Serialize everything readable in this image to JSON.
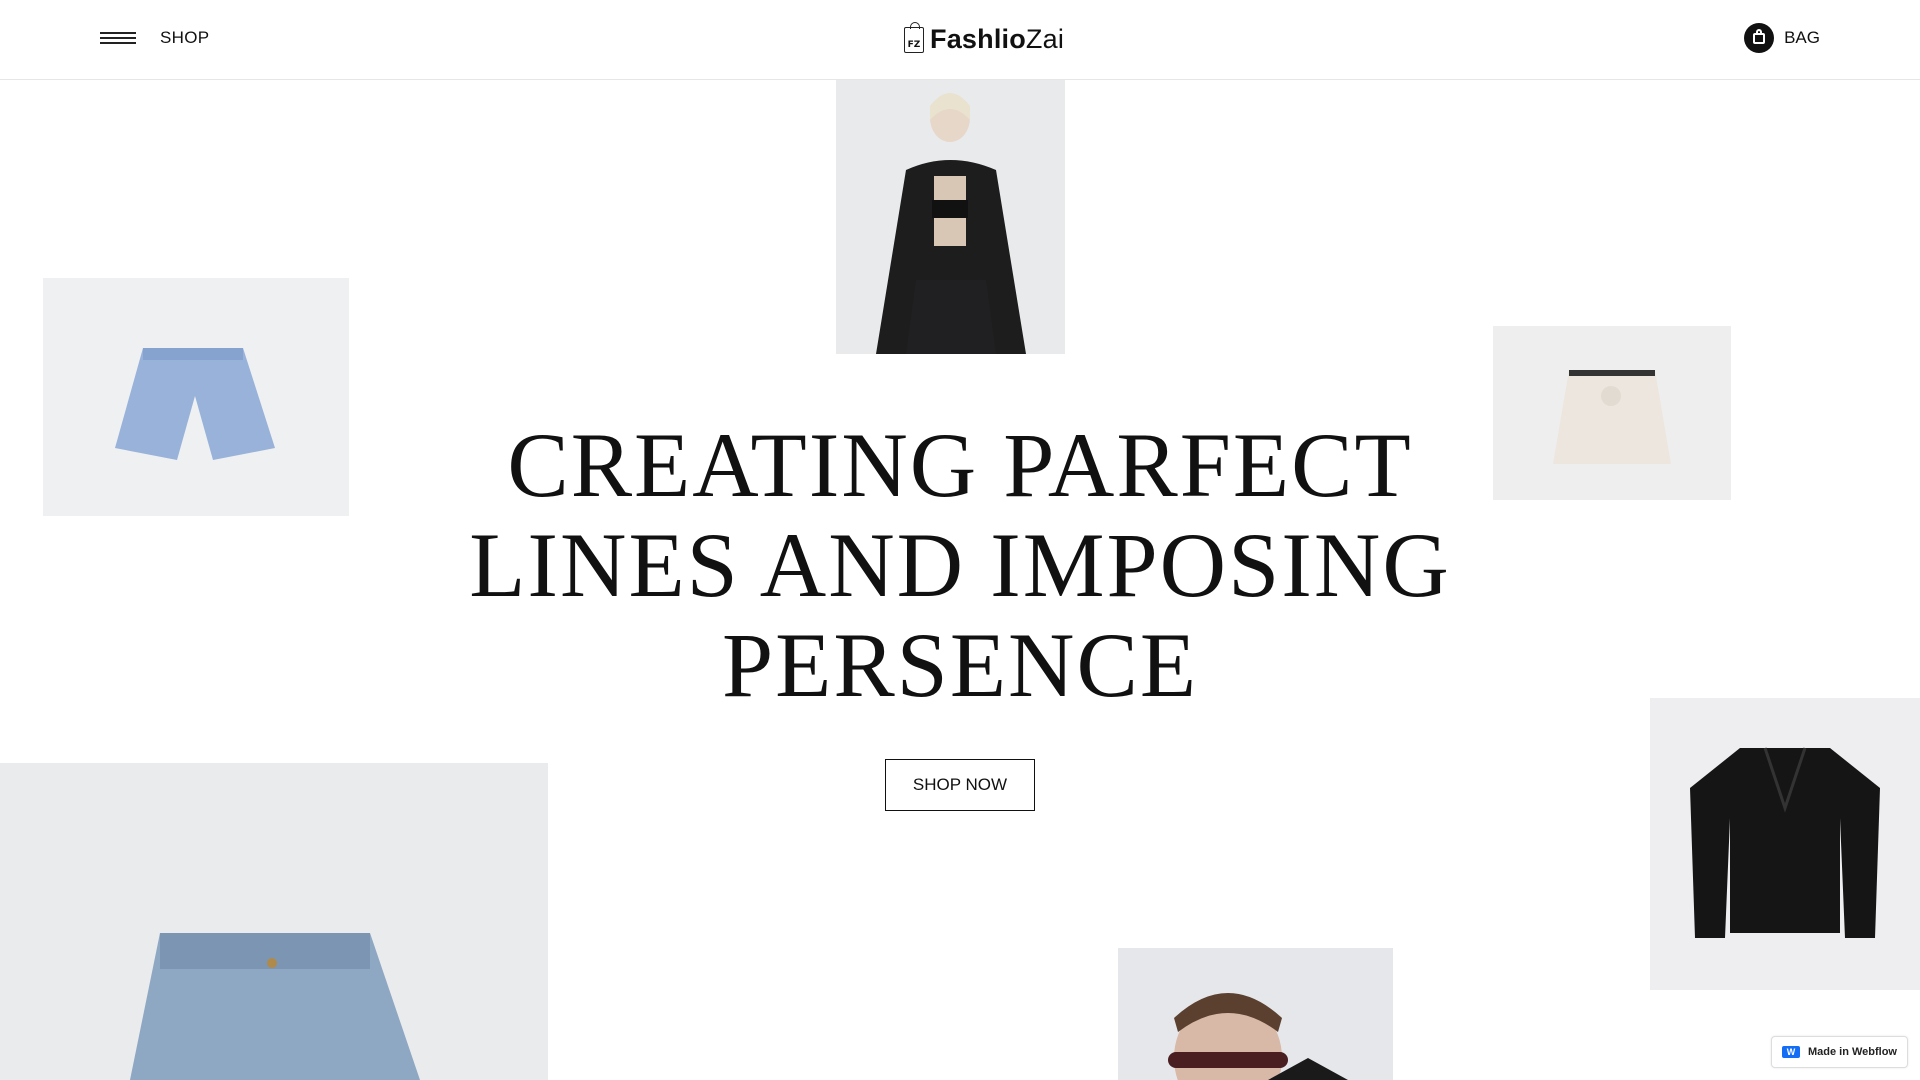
{
  "header": {
    "menu_label": "SHOP",
    "logo_mark": "FZ",
    "logo_bold": "Fashlio",
    "logo_light": "Zai",
    "bag_label": "BAG"
  },
  "hero": {
    "line1": "CREATING PARFECT",
    "line2": "LINES AND IMPOSING",
    "line3": "PERSENCE",
    "cta_label": "SHOP NOW"
  },
  "badge": {
    "icon_text": "W",
    "label": "Made in Webflow"
  },
  "icons": [
    "menu-icon",
    "logo-bag-icon",
    "bag-icon",
    "webflow-icon"
  ]
}
